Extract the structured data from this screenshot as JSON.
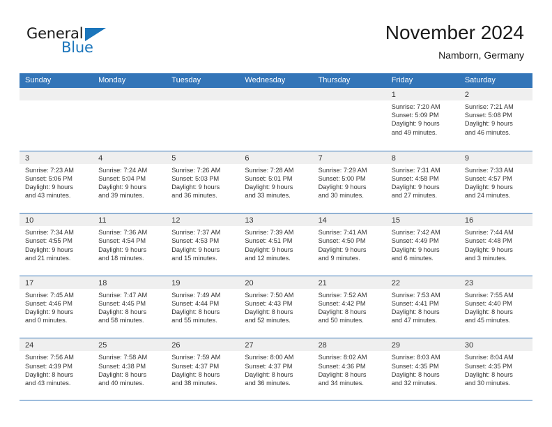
{
  "logo": {
    "word_top": "General",
    "word_bottom": "Blue",
    "accent_color": "#1b75bb"
  },
  "header": {
    "title": "November 2024",
    "subtitle": "Namborn, Germany"
  },
  "theme": {
    "header_bar_color": "#3375b8",
    "day_strip_color": "#efefef",
    "text_color": "#333333"
  },
  "calendar": {
    "weekdays": [
      "Sunday",
      "Monday",
      "Tuesday",
      "Wednesday",
      "Thursday",
      "Friday",
      "Saturday"
    ],
    "weeks": [
      [
        {
          "day": "",
          "empty": true
        },
        {
          "day": "",
          "empty": true
        },
        {
          "day": "",
          "empty": true
        },
        {
          "day": "",
          "empty": true
        },
        {
          "day": "",
          "empty": true
        },
        {
          "day": "1",
          "sunrise": "Sunrise: 7:20 AM",
          "sunset": "Sunset: 5:09 PM",
          "daylight1": "Daylight: 9 hours",
          "daylight2": "and 49 minutes."
        },
        {
          "day": "2",
          "sunrise": "Sunrise: 7:21 AM",
          "sunset": "Sunset: 5:08 PM",
          "daylight1": "Daylight: 9 hours",
          "daylight2": "and 46 minutes."
        }
      ],
      [
        {
          "day": "3",
          "sunrise": "Sunrise: 7:23 AM",
          "sunset": "Sunset: 5:06 PM",
          "daylight1": "Daylight: 9 hours",
          "daylight2": "and 43 minutes."
        },
        {
          "day": "4",
          "sunrise": "Sunrise: 7:24 AM",
          "sunset": "Sunset: 5:04 PM",
          "daylight1": "Daylight: 9 hours",
          "daylight2": "and 39 minutes."
        },
        {
          "day": "5",
          "sunrise": "Sunrise: 7:26 AM",
          "sunset": "Sunset: 5:03 PM",
          "daylight1": "Daylight: 9 hours",
          "daylight2": "and 36 minutes."
        },
        {
          "day": "6",
          "sunrise": "Sunrise: 7:28 AM",
          "sunset": "Sunset: 5:01 PM",
          "daylight1": "Daylight: 9 hours",
          "daylight2": "and 33 minutes."
        },
        {
          "day": "7",
          "sunrise": "Sunrise: 7:29 AM",
          "sunset": "Sunset: 5:00 PM",
          "daylight1": "Daylight: 9 hours",
          "daylight2": "and 30 minutes."
        },
        {
          "day": "8",
          "sunrise": "Sunrise: 7:31 AM",
          "sunset": "Sunset: 4:58 PM",
          "daylight1": "Daylight: 9 hours",
          "daylight2": "and 27 minutes."
        },
        {
          "day": "9",
          "sunrise": "Sunrise: 7:33 AM",
          "sunset": "Sunset: 4:57 PM",
          "daylight1": "Daylight: 9 hours",
          "daylight2": "and 24 minutes."
        }
      ],
      [
        {
          "day": "10",
          "sunrise": "Sunrise: 7:34 AM",
          "sunset": "Sunset: 4:55 PM",
          "daylight1": "Daylight: 9 hours",
          "daylight2": "and 21 minutes."
        },
        {
          "day": "11",
          "sunrise": "Sunrise: 7:36 AM",
          "sunset": "Sunset: 4:54 PM",
          "daylight1": "Daylight: 9 hours",
          "daylight2": "and 18 minutes."
        },
        {
          "day": "12",
          "sunrise": "Sunrise: 7:37 AM",
          "sunset": "Sunset: 4:53 PM",
          "daylight1": "Daylight: 9 hours",
          "daylight2": "and 15 minutes."
        },
        {
          "day": "13",
          "sunrise": "Sunrise: 7:39 AM",
          "sunset": "Sunset: 4:51 PM",
          "daylight1": "Daylight: 9 hours",
          "daylight2": "and 12 minutes."
        },
        {
          "day": "14",
          "sunrise": "Sunrise: 7:41 AM",
          "sunset": "Sunset: 4:50 PM",
          "daylight1": "Daylight: 9 hours",
          "daylight2": "and 9 minutes."
        },
        {
          "day": "15",
          "sunrise": "Sunrise: 7:42 AM",
          "sunset": "Sunset: 4:49 PM",
          "daylight1": "Daylight: 9 hours",
          "daylight2": "and 6 minutes."
        },
        {
          "day": "16",
          "sunrise": "Sunrise: 7:44 AM",
          "sunset": "Sunset: 4:48 PM",
          "daylight1": "Daylight: 9 hours",
          "daylight2": "and 3 minutes."
        }
      ],
      [
        {
          "day": "17",
          "sunrise": "Sunrise: 7:45 AM",
          "sunset": "Sunset: 4:46 PM",
          "daylight1": "Daylight: 9 hours",
          "daylight2": "and 0 minutes."
        },
        {
          "day": "18",
          "sunrise": "Sunrise: 7:47 AM",
          "sunset": "Sunset: 4:45 PM",
          "daylight1": "Daylight: 8 hours",
          "daylight2": "and 58 minutes."
        },
        {
          "day": "19",
          "sunrise": "Sunrise: 7:49 AM",
          "sunset": "Sunset: 4:44 PM",
          "daylight1": "Daylight: 8 hours",
          "daylight2": "and 55 minutes."
        },
        {
          "day": "20",
          "sunrise": "Sunrise: 7:50 AM",
          "sunset": "Sunset: 4:43 PM",
          "daylight1": "Daylight: 8 hours",
          "daylight2": "and 52 minutes."
        },
        {
          "day": "21",
          "sunrise": "Sunrise: 7:52 AM",
          "sunset": "Sunset: 4:42 PM",
          "daylight1": "Daylight: 8 hours",
          "daylight2": "and 50 minutes."
        },
        {
          "day": "22",
          "sunrise": "Sunrise: 7:53 AM",
          "sunset": "Sunset: 4:41 PM",
          "daylight1": "Daylight: 8 hours",
          "daylight2": "and 47 minutes."
        },
        {
          "day": "23",
          "sunrise": "Sunrise: 7:55 AM",
          "sunset": "Sunset: 4:40 PM",
          "daylight1": "Daylight: 8 hours",
          "daylight2": "and 45 minutes."
        }
      ],
      [
        {
          "day": "24",
          "sunrise": "Sunrise: 7:56 AM",
          "sunset": "Sunset: 4:39 PM",
          "daylight1": "Daylight: 8 hours",
          "daylight2": "and 43 minutes."
        },
        {
          "day": "25",
          "sunrise": "Sunrise: 7:58 AM",
          "sunset": "Sunset: 4:38 PM",
          "daylight1": "Daylight: 8 hours",
          "daylight2": "and 40 minutes."
        },
        {
          "day": "26",
          "sunrise": "Sunrise: 7:59 AM",
          "sunset": "Sunset: 4:37 PM",
          "daylight1": "Daylight: 8 hours",
          "daylight2": "and 38 minutes."
        },
        {
          "day": "27",
          "sunrise": "Sunrise: 8:00 AM",
          "sunset": "Sunset: 4:37 PM",
          "daylight1": "Daylight: 8 hours",
          "daylight2": "and 36 minutes."
        },
        {
          "day": "28",
          "sunrise": "Sunrise: 8:02 AM",
          "sunset": "Sunset: 4:36 PM",
          "daylight1": "Daylight: 8 hours",
          "daylight2": "and 34 minutes."
        },
        {
          "day": "29",
          "sunrise": "Sunrise: 8:03 AM",
          "sunset": "Sunset: 4:35 PM",
          "daylight1": "Daylight: 8 hours",
          "daylight2": "and 32 minutes."
        },
        {
          "day": "30",
          "sunrise": "Sunrise: 8:04 AM",
          "sunset": "Sunset: 4:35 PM",
          "daylight1": "Daylight: 8 hours",
          "daylight2": "and 30 minutes."
        }
      ]
    ]
  }
}
